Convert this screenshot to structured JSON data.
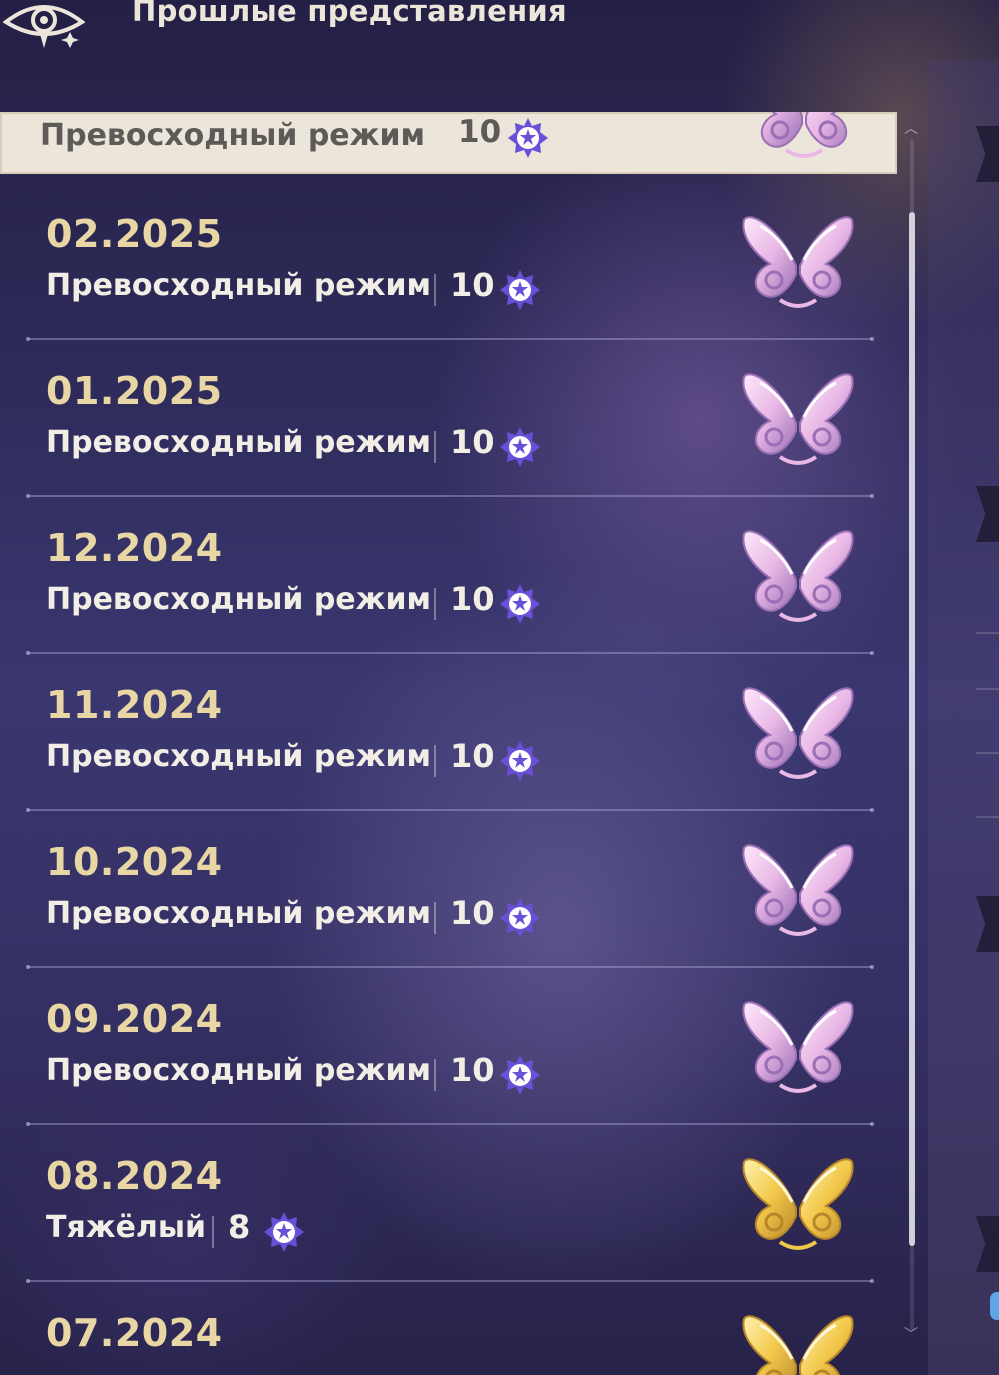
{
  "header": {
    "title": "Прошлые представления",
    "icon": "eye-emblem-icon"
  },
  "selected": {
    "mode": "Превосходный режим",
    "score": "10",
    "badge": "pink"
  },
  "rows": [
    {
      "date": "02.2025",
      "mode": "Превосходный режим",
      "score": "10",
      "badge": "pink"
    },
    {
      "date": "01.2025",
      "mode": "Превосходный режим",
      "score": "10",
      "badge": "pink"
    },
    {
      "date": "12.2024",
      "mode": "Превосходный режим",
      "score": "10",
      "badge": "pink"
    },
    {
      "date": "11.2024",
      "mode": "Превосходный режим",
      "score": "10",
      "badge": "pink"
    },
    {
      "date": "10.2024",
      "mode": "Превосходный режим",
      "score": "10",
      "badge": "pink"
    },
    {
      "date": "09.2024",
      "mode": "Превосходный режим",
      "score": "10",
      "badge": "pink"
    },
    {
      "date": "08.2024",
      "mode": "Тяжёлый",
      "score": "8",
      "badge": "gold"
    },
    {
      "date": "07.2024",
      "mode": "",
      "score": "",
      "badge": "gold"
    }
  ],
  "colors": {
    "date": "#e8d6a4",
    "text": "#f2eee6",
    "selected_bg": "#ece6da",
    "star": "#6a4fd8",
    "badge_pink": "#e9b8e6",
    "badge_gold": "#f2c84a"
  }
}
